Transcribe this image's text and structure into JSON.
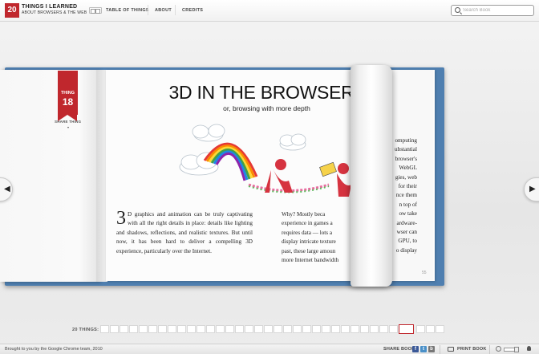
{
  "header": {
    "logo_number": "20",
    "logo_title": "THINGS I LEARNED",
    "logo_subtitle": "ABOUT BROWSERS & THE WEB",
    "nav": [
      "TABLE OF THINGS",
      "ABOUT",
      "CREDITS"
    ],
    "search_placeholder": "Search Book"
  },
  "left_page": {
    "ribbon_label": "THING",
    "ribbon_number": "18",
    "share_label": "SHARE THING",
    "share_caret": "▾"
  },
  "right_page": {
    "title": "3D IN THE BROWSER",
    "subtitle": "or, browsing with more depth",
    "drop_cap": "3",
    "column_left": "D graphics and animation can be truly captivating with all the right details in place: details like lighting and shadows, reflections, and realistic textures. But until now, it has been hard to deliver a compelling 3D experience, particularly over the Internet.",
    "column_right_lines": [
      "Why?  Mostly  beca",
      "experience in games a",
      "requires data — lots a",
      "display intricate texture",
      "past, these large amoun",
      "more Internet bandwidth"
    ],
    "page_number": "55"
  },
  "curl_page_lines": [
    "omputing",
    "ubstantial",
    "browser's",
    "WebGL",
    "gies, web",
    "for their",
    "nce them",
    "n top of",
    "ow take",
    "ardware-",
    "wser can",
    "GPU, to",
    "o display"
  ],
  "navigation": {
    "prev_glyph": "◀",
    "next_glyph": "▶"
  },
  "thumbnails": {
    "label": "20 THINGS:",
    "count": 35,
    "active_index": 31
  },
  "footer": {
    "credit": "Brought to you by the Google Chrome team, 2010",
    "share_label": "SHARE BOOK:",
    "social": [
      {
        "name": "facebook",
        "glyph": "f",
        "color": "#3b5998"
      },
      {
        "name": "twitter",
        "glyph": "t",
        "color": "#4a90c8"
      },
      {
        "name": "buzz",
        "glyph": "b",
        "color": "#777777"
      }
    ],
    "print_label": "PRINT BOOK"
  },
  "colors": {
    "brand_red": "#c0272d",
    "cover_blue": "#4f7fb0"
  }
}
